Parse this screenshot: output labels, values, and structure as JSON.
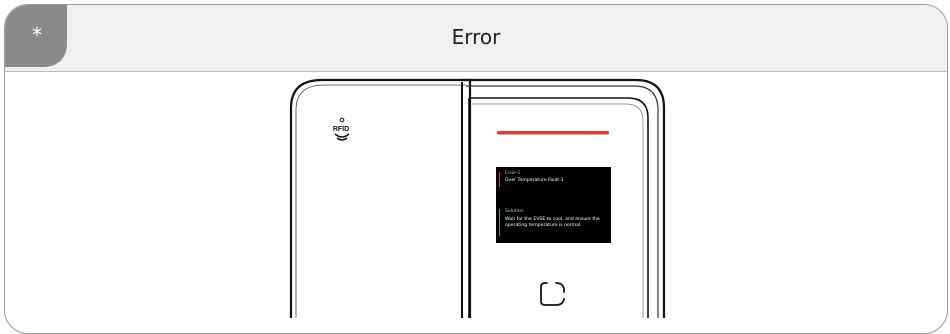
{
  "header": {
    "corner_mark": "*",
    "title": "Error"
  },
  "device": {
    "rfid_label": "RFID",
    "indicator_color": "#e53935",
    "screen": {
      "error_label": "Error-1",
      "error_message": "Over Temperature Fault-1",
      "solution_label": "Solution",
      "solution_text": "Wait for the EVSE to cool, and ensure the operating temperature is normal."
    }
  }
}
